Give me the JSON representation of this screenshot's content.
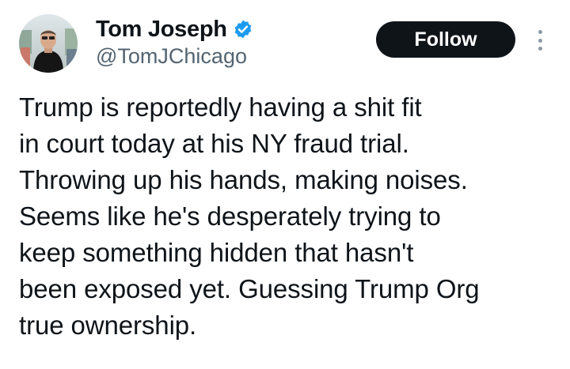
{
  "author": {
    "display_name": "Tom Joseph",
    "handle": "@TomJChicago",
    "verified_icon": "verified-badge-icon",
    "avatar_icon": "profile-photo"
  },
  "actions": {
    "follow_label": "Follow",
    "more_icon": "more-vertical-icon"
  },
  "tweet": {
    "text": "Trump is reportedly having a shit fit\nin court today at his NY fraud trial.\nThrowing up his hands, making noises.\nSeems like he's desperately trying to\nkeep something hidden that hasn't\nbeen exposed yet. Guessing Trump Org\ntrue ownership."
  },
  "colors": {
    "text": "#0f1419",
    "secondary_text": "#536471",
    "follow_button_bg": "#0f1419",
    "follow_button_text": "#ffffff",
    "verified": "#1d9bf0"
  }
}
